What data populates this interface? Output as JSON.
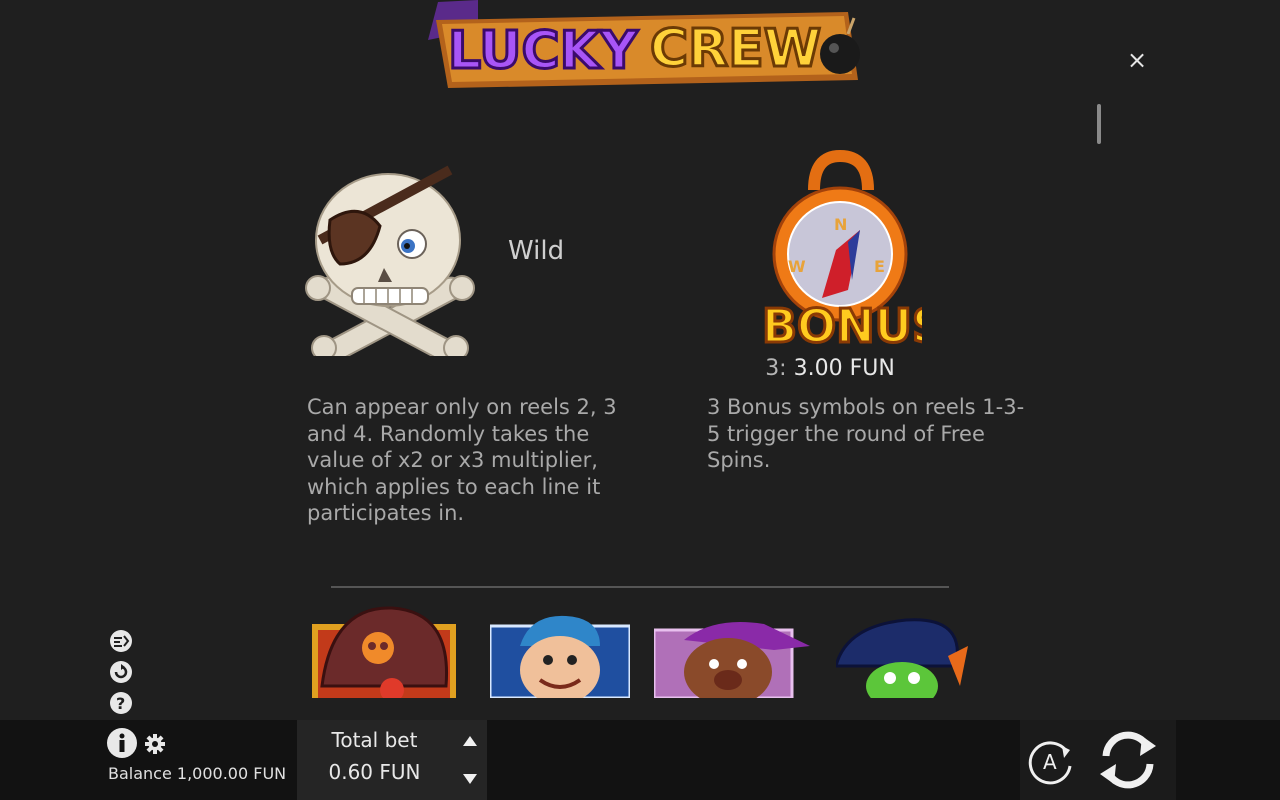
{
  "header": {
    "logo": {
      "word1": "LUCKY",
      "word2": "CREW"
    },
    "close_icon": "×"
  },
  "symbols": [
    {
      "name": "Wild",
      "description": "Can appear only on reels 2, 3 and 4. Randomly takes the value of x2 or x3 multiplier, which applies to each line it participates in."
    },
    {
      "name": "BONUS",
      "payout_count": "3:",
      "payout_value": "3.00 FUN",
      "description": "3 Bonus symbols on reels 1-3-5 trigger the round of Free Spins."
    }
  ],
  "side_icons": [
    "turbo-icon",
    "autoplay-icon",
    "help-icon"
  ],
  "bottom_bar": {
    "balance": "Balance 1,000.00 FUN",
    "total_bet_label": "Total bet",
    "total_bet_value": "0.60 FUN",
    "auto_label": "A"
  }
}
